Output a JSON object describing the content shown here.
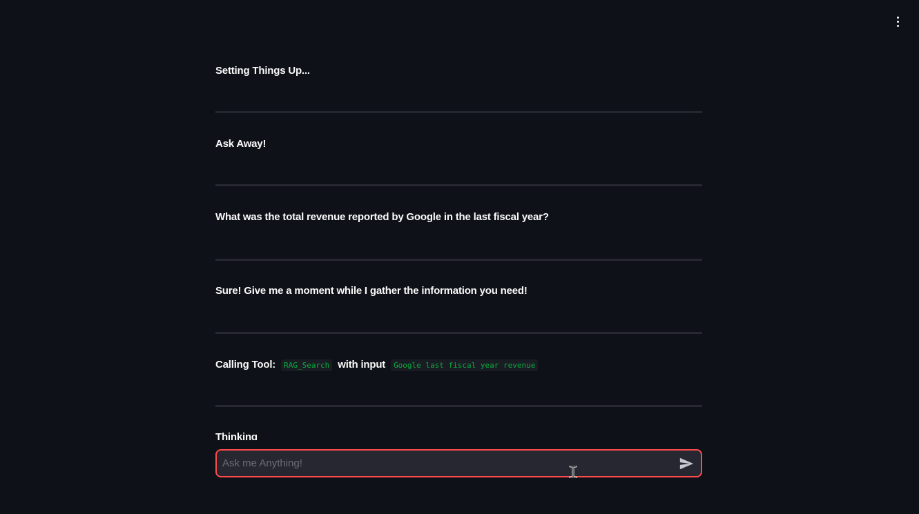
{
  "chat": {
    "messages": [
      {
        "text": "Setting Things Up..."
      },
      {
        "text": "Ask Away!"
      },
      {
        "text": "What was the total revenue reported by Google in the last fiscal year?"
      },
      {
        "text": "Sure! Give me a moment while I gather the information you need!"
      }
    ],
    "tool_call": {
      "prefix": "Calling Tool:",
      "tool_name": "RAG_Search",
      "middle": "with input",
      "tool_input": "Google last fiscal year revenue"
    },
    "thinking": "Thinking"
  },
  "input": {
    "placeholder": "Ask me Anything!",
    "value": ""
  },
  "icons": {
    "menu": "vertical-ellipsis-icon",
    "send": "send-arrow-icon",
    "cursor": "text-cursor-icon"
  },
  "colors": {
    "background": "#0e1117",
    "input_border": "#ff4b4b",
    "code_text": "#09ab3b",
    "divider": "#262730"
  }
}
